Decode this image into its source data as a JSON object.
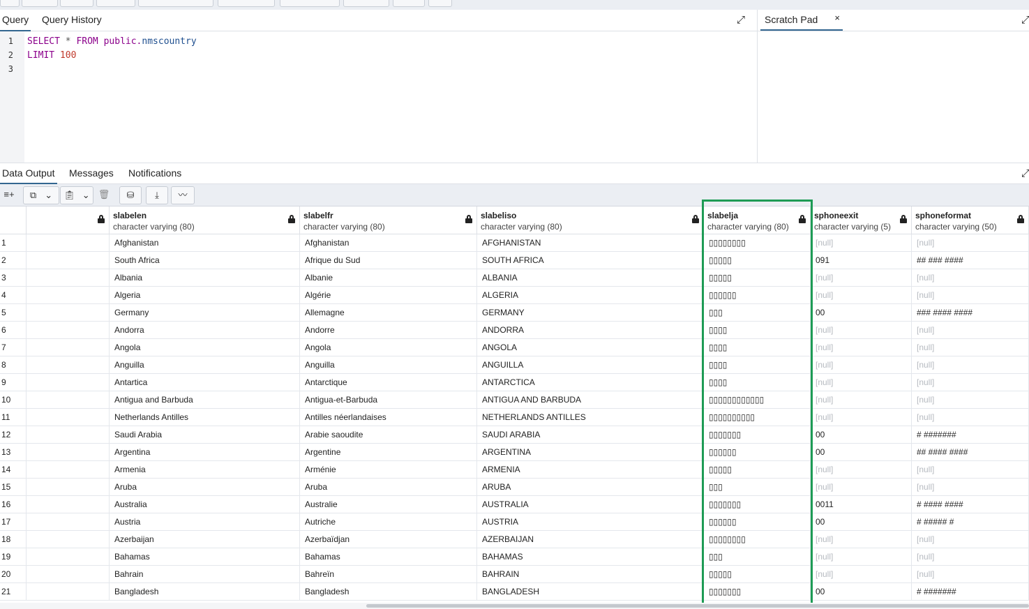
{
  "editor": {
    "tabs": [
      "Query",
      "Query History"
    ],
    "lines": [
      {
        "num": "1",
        "kw1": "SELECT",
        "op": " * ",
        "kw2": "FROM",
        "schema": " public.",
        "table": "nmscountry"
      },
      {
        "num": "2",
        "kw": "LIMIT",
        "value": " 100"
      },
      {
        "num": "3"
      }
    ]
  },
  "scratch": {
    "tab_label": "Scratch Pad",
    "close_glyph": "×"
  },
  "results": {
    "tabs": [
      "Data Output",
      "Messages",
      "Notifications"
    ],
    "columns": [
      {
        "name": "",
        "type": ""
      },
      {
        "name": "slabelen",
        "type": "character varying (80)"
      },
      {
        "name": "slabelfr",
        "type": "character varying (80)"
      },
      {
        "name": "slabeliso",
        "type": "character varying (80)"
      },
      {
        "name": "slabelja",
        "type": "character varying (80)"
      },
      {
        "name": "sphoneexit",
        "type": "character varying (5)"
      },
      {
        "name": "sphoneformat",
        "type": "character varying (50)"
      }
    ],
    "rows": [
      [
        "1",
        "",
        "Afghanistan",
        "Afghanistan",
        "AFGHANISTAN",
        "▯▯▯▯▯▯▯▯",
        "[null]",
        "[null]"
      ],
      [
        "2",
        "",
        "South Africa",
        "Afrique du Sud",
        "SOUTH AFRICA",
        "▯▯▯▯▯",
        "091",
        "## ### ####"
      ],
      [
        "3",
        "",
        "Albania",
        "Albanie",
        "ALBANIA",
        "▯▯▯▯▯",
        "[null]",
        "[null]"
      ],
      [
        "4",
        "",
        "Algeria",
        "Algérie",
        "ALGERIA",
        "▯▯▯▯▯▯",
        "[null]",
        "[null]"
      ],
      [
        "5",
        "",
        "Germany",
        "Allemagne",
        "GERMANY",
        "▯▯▯",
        "00",
        "### #### ####"
      ],
      [
        "6",
        "",
        "Andorra",
        "Andorre",
        "ANDORRA",
        "▯▯▯▯",
        "[null]",
        "[null]"
      ],
      [
        "7",
        "",
        "Angola",
        "Angola",
        "ANGOLA",
        "▯▯▯▯",
        "[null]",
        "[null]"
      ],
      [
        "8",
        "",
        "Anguilla",
        "Anguilla",
        "ANGUILLA",
        "▯▯▯▯",
        "[null]",
        "[null]"
      ],
      [
        "9",
        "",
        "Antartica",
        "Antarctique",
        "ANTARCTICA",
        "▯▯▯▯",
        "[null]",
        "[null]"
      ],
      [
        "10",
        "",
        "Antigua and Barbuda",
        "Antigua-et-Barbuda",
        "ANTIGUA AND BARBUDA",
        "▯▯▯▯▯▯▯▯▯▯▯▯",
        "[null]",
        "[null]"
      ],
      [
        "11",
        "",
        "Netherlands Antilles",
        "Antilles néerlandaises",
        "NETHERLANDS ANTILLES",
        "▯▯▯▯▯▯▯▯▯▯",
        "[null]",
        "[null]"
      ],
      [
        "12",
        "",
        "Saudi Arabia",
        "Arabie saoudite",
        "SAUDI ARABIA",
        "▯▯▯▯▯▯▯",
        "00",
        "# #######"
      ],
      [
        "13",
        "",
        "Argentina",
        "Argentine",
        "ARGENTINA",
        "▯▯▯▯▯▯",
        "00",
        "## #### ####"
      ],
      [
        "14",
        "",
        "Armenia",
        "Arménie",
        "ARMENIA",
        "▯▯▯▯▯",
        "[null]",
        "[null]"
      ],
      [
        "15",
        "",
        "Aruba",
        "Aruba",
        "ARUBA",
        "▯▯▯",
        "[null]",
        "[null]"
      ],
      [
        "16",
        "",
        "Australia",
        "Australie",
        "AUSTRALIA",
        "▯▯▯▯▯▯▯",
        "0011",
        "# #### ####"
      ],
      [
        "17",
        "",
        "Austria",
        "Autriche",
        "AUSTRIA",
        "▯▯▯▯▯▯",
        "00",
        "# ##### #"
      ],
      [
        "18",
        "",
        "Azerbaijan",
        "Azerbaïdjan",
        "AZERBAIJAN",
        "▯▯▯▯▯▯▯▯",
        "[null]",
        "[null]"
      ],
      [
        "19",
        "",
        "Bahamas",
        "Bahamas",
        "BAHAMAS",
        "▯▯▯",
        "[null]",
        "[null]"
      ],
      [
        "20",
        "",
        "Bahrain",
        "Bahreïn",
        "BAHRAIN",
        "▯▯▯▯▯",
        "[null]",
        "[null]"
      ],
      [
        "21",
        "",
        "Bangladesh",
        "Bangladesh",
        "BANGLADESH",
        "▯▯▯▯▯▯▯",
        "00",
        "# #######"
      ]
    ]
  },
  "colors": {
    "accent": "#326690",
    "highlight": "#1e9b55",
    "null_text": "#b6bac0"
  }
}
